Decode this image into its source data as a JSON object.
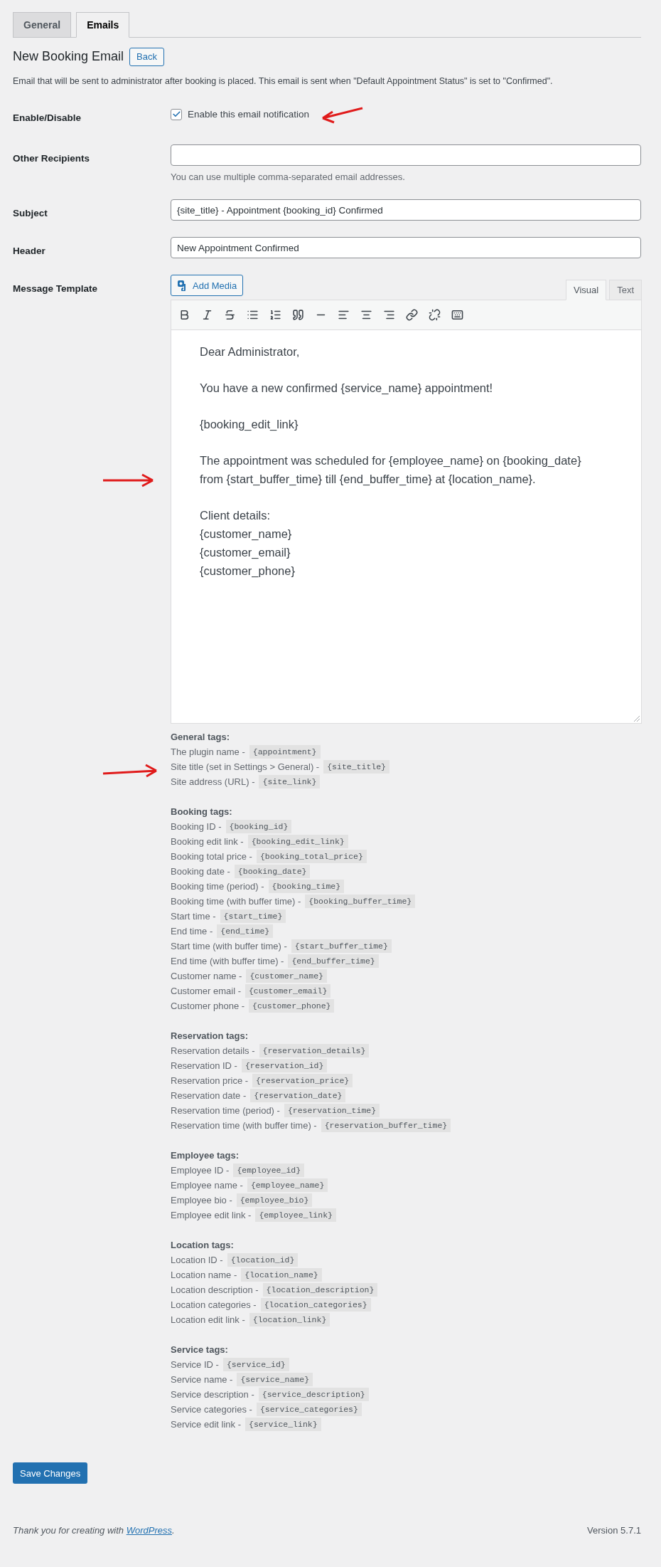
{
  "tabs": [
    {
      "label": "General",
      "selected": false
    },
    {
      "label": "Emails",
      "selected": true
    }
  ],
  "title": "New Booking Email",
  "back_button": "Back",
  "description": "Email that will be sent to administrator after booking is placed. This email is sent when \"Default Appointment Status\" is set to \"Confirmed\".",
  "fields": [
    {
      "kind": "checkbox",
      "label": "Enable/Disable",
      "text": "Enable this email notification",
      "checked": true
    },
    {
      "kind": "text",
      "label": "Other Recipients",
      "help": "You can use multiple comma-separated email addresses."
    },
    {
      "kind": "text",
      "label": "Subject",
      "value": "{site_title} - Appointment {booking_id} Confirmed"
    },
    {
      "kind": "text",
      "label": "Header",
      "value": "New Appointment Confirmed"
    }
  ],
  "message_template": {
    "label": "Message Template",
    "add_media": "Add Media",
    "editor_tabs": [
      {
        "label": "Visual",
        "selected": true
      },
      {
        "label": "Text",
        "selected": false
      }
    ],
    "paragraphs": [
      [
        "Dear Administrator,"
      ],
      [
        "You have a new confirmed {service_name} appointment!"
      ],
      [
        "{booking_edit_link}"
      ],
      [
        "The appointment was scheduled for {employee_name} on {booking_date}",
        "from {start_buffer_time} till {end_buffer_time} at {location_name}."
      ],
      [
        "Client details:",
        "{customer_name}",
        "{customer_email}",
        "{customer_phone}"
      ]
    ]
  },
  "tag_groups": [
    {
      "heading": "General tags:",
      "tags": [
        {
          "label": "The plugin name -",
          "code": "{appointment}"
        },
        {
          "label": "Site title (set in Settings > General) -",
          "code": "{site_title}"
        },
        {
          "label": "Site address (URL) -",
          "code": "{site_link}"
        }
      ]
    },
    {
      "heading": "Booking tags:",
      "tags": [
        {
          "label": "Booking ID -",
          "code": "{booking_id}"
        },
        {
          "label": "Booking edit link -",
          "code": "{booking_edit_link}"
        },
        {
          "label": "Booking total price -",
          "code": "{booking_total_price}"
        },
        {
          "label": "Booking date -",
          "code": "{booking_date}"
        },
        {
          "label": "Booking time (period) -",
          "code": "{booking_time}"
        },
        {
          "label": "Booking time (with buffer time) -",
          "code": "{booking_buffer_time}"
        },
        {
          "label": "Start time -",
          "code": "{start_time}"
        },
        {
          "label": "End time -",
          "code": "{end_time}"
        },
        {
          "label": "Start time (with buffer time) -",
          "code": "{start_buffer_time}"
        },
        {
          "label": "End time (with buffer time) -",
          "code": "{end_buffer_time}"
        },
        {
          "label": "Customer name -",
          "code": "{customer_name}"
        },
        {
          "label": "Customer email -",
          "code": "{customer_email}"
        },
        {
          "label": "Customer phone -",
          "code": "{customer_phone}"
        }
      ]
    },
    {
      "heading": "Reservation tags:",
      "tags": [
        {
          "label": "Reservation details -",
          "code": "{reservation_details}"
        },
        {
          "label": "Reservation ID -",
          "code": "{reservation_id}"
        },
        {
          "label": "Reservation price -",
          "code": "{reservation_price}"
        },
        {
          "label": "Reservation date -",
          "code": "{reservation_date}"
        },
        {
          "label": "Reservation time (period) -",
          "code": "{reservation_time}"
        },
        {
          "label": "Reservation time (with buffer time) -",
          "code": "{reservation_buffer_time}"
        }
      ]
    },
    {
      "heading": "Employee tags:",
      "tags": [
        {
          "label": "Employee ID -",
          "code": "{employee_id}"
        },
        {
          "label": "Employee name -",
          "code": "{employee_name}"
        },
        {
          "label": "Employee bio -",
          "code": "{employee_bio}"
        },
        {
          "label": "Employee edit link -",
          "code": "{employee_link}"
        }
      ]
    },
    {
      "heading": "Location tags:",
      "tags": [
        {
          "label": "Location ID -",
          "code": "{location_id}"
        },
        {
          "label": "Location name -",
          "code": "{location_name}"
        },
        {
          "label": "Location description -",
          "code": "{location_description}"
        },
        {
          "label": "Location categories -",
          "code": "{location_categories}"
        },
        {
          "label": "Location edit link -",
          "code": "{location_link}"
        }
      ]
    },
    {
      "heading": "Service tags:",
      "tags": [
        {
          "label": "Service ID -",
          "code": "{service_id}"
        },
        {
          "label": "Service name -",
          "code": "{service_name}"
        },
        {
          "label": "Service description -",
          "code": "{service_description}"
        },
        {
          "label": "Service categories -",
          "code": "{service_categories}"
        },
        {
          "label": "Service edit link -",
          "code": "{service_link}"
        }
      ]
    }
  ],
  "save_button": "Save Changes",
  "footer": {
    "text": "Thank you for creating with",
    "link": "WordPress",
    "end": ".",
    "version": "Version 5.7.1"
  }
}
